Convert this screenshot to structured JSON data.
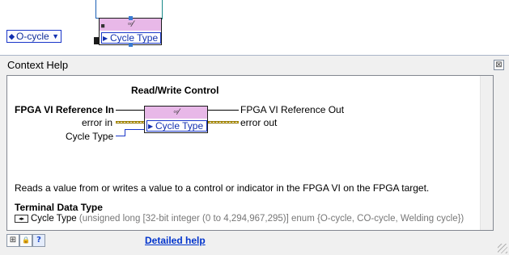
{
  "diagram": {
    "enum_constant": {
      "value": "O-cycle"
    },
    "node": {
      "terminal_label": "Cycle Type"
    }
  },
  "help": {
    "window_title": "Context Help",
    "close_label": "⊠",
    "function_title": "Read/Write Control",
    "terminals": {
      "ref_in": "FPGA VI Reference In",
      "error_in": "error in",
      "cycle_type": "Cycle Type",
      "ref_out": "FPGA VI Reference Out",
      "error_out": "error out"
    },
    "node_label": "Cycle Type",
    "description": "Reads a value from or writes a value to a control or indicator in the FPGA VI on the FPGA target.",
    "terminal_data_type": {
      "heading": "Terminal Data Type",
      "name": "Cycle Type",
      "type_text": "(unsigned long [32-bit integer (0 to 4,294,967,295)] enum {O-cycle, CO-cycle, Welding cycle})"
    },
    "detailed_help": "Detailed help",
    "bottom_buttons": [
      {
        "name": "show-optional-terminals-button",
        "glyph": "⊞"
      },
      {
        "name": "lock-button",
        "glyph": "🔒"
      },
      {
        "name": "help-button",
        "glyph": "?"
      }
    ]
  },
  "icons": [
    "enum-ring-icon",
    "dropdown-arrow-icon",
    "read-write-control-icon",
    "close-icon",
    "resize-grip-icon"
  ],
  "colors": {
    "wire_blue": "#1a37c9",
    "node_header": "#e8b8e8",
    "error_wire": "#d4b400",
    "link": "#0033cc"
  }
}
